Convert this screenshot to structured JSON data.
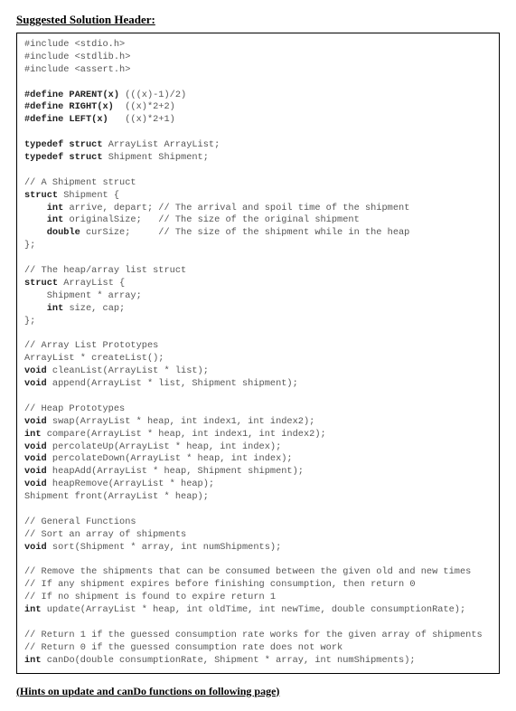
{
  "header": {
    "title": "Suggested Solution Header:"
  },
  "code": {
    "l1": "#include <stdio.h>",
    "l2": "#include <stdlib.h>",
    "l3": "#include <assert.h>",
    "l4": "",
    "l5a": "#define PARENT(x)",
    "l5b": " (((x)-1)/2)",
    "l6a": "#define RIGHT(x)",
    "l6b": "  ((x)*2+2)",
    "l7a": "#define LEFT(x)",
    "l7b": "   ((x)*2+1)",
    "l8": "",
    "l9a": "typedef struct",
    "l9b": " ArrayList ArrayList;",
    "l10a": "typedef struct",
    "l10b": " Shipment Shipment;",
    "l11": "",
    "l12": "// A Shipment struct",
    "l13a": "struct",
    "l13b": " Shipment {",
    "l14a": "    int",
    "l14b": " arrive, depart; // The arrival and spoil time of the shipment",
    "l15a": "    int",
    "l15b": " originalSize;   // The size of the original shipment",
    "l16a": "    double",
    "l16b": " curSize;     // The size of the shipment while in the heap",
    "l17": "};",
    "l18": "",
    "l19": "// The heap/array list struct",
    "l20a": "struct",
    "l20b": " ArrayList {",
    "l21": "    Shipment * array;",
    "l22a": "    int",
    "l22b": " size, cap;",
    "l23": "};",
    "l24": "",
    "l25": "// Array List Prototypes",
    "l26": "ArrayList * createList();",
    "l27a": "void",
    "l27b": " cleanList(ArrayList * list);",
    "l28a": "void",
    "l28b": " append(ArrayList * list, Shipment shipment);",
    "l29": "",
    "l30": "// Heap Prototypes",
    "l31a": "void",
    "l31b": " swap(ArrayList * heap, int index1, int index2);",
    "l32a": "int",
    "l32b": " compare(ArrayList * heap, int index1, int index2);",
    "l33a": "void",
    "l33b": " percolateUp(ArrayList * heap, int index);",
    "l34a": "void",
    "l34b": " percolateDown(ArrayList * heap, int index);",
    "l35a": "void",
    "l35b": " heapAdd(ArrayList * heap, Shipment shipment);",
    "l36a": "void",
    "l36b": " heapRemove(ArrayList * heap);",
    "l37": "Shipment front(ArrayList * heap);",
    "l38": "",
    "l39": "// General Functions",
    "l40": "// Sort an array of shipments",
    "l41a": "void",
    "l41b": " sort(Shipment * array, int numShipments);",
    "l42": "",
    "l43": "// Remove the shipments that can be consumed between the given old and new times",
    "l44": "// If any shipment expires before finishing consumption, then return 0",
    "l45": "// If no shipment is found to expire return 1",
    "l46a": "int",
    "l46b": " update(ArrayList * heap, int oldTime, int newTime, double consumptionRate);",
    "l47": "",
    "l48": "// Return 1 if the guessed consumption rate works for the given array of shipments",
    "l49": "// Return 0 if the guessed consumption rate does not work",
    "l50a": "int",
    "l50b": " canDo(double consumptionRate, Shipment * array, int numShipments);"
  },
  "footer": {
    "hint": "(Hints on update and canDo functions on following page)"
  }
}
